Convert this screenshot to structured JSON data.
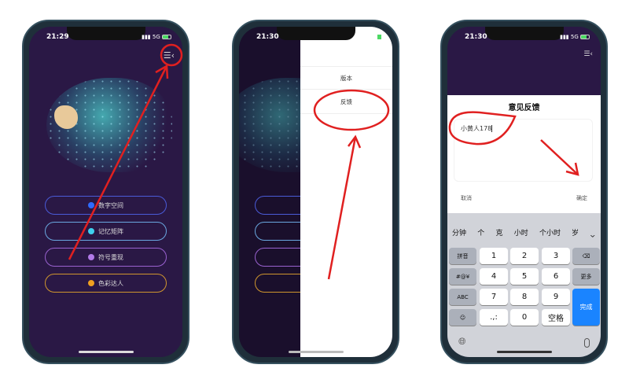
{
  "phone1": {
    "time": "21:29",
    "network": "5G",
    "menu_icon": "menu-collapse-icon",
    "buttons": [
      {
        "label": "数字空间",
        "color": "#2f6bff",
        "border": "#4a5bd8"
      },
      {
        "label": "记忆矩阵",
        "color": "#3fd0ee",
        "border": "#6aa8e0"
      },
      {
        "label": "符号重现",
        "color": "#b27be8",
        "border": "#9a62d0"
      },
      {
        "label": "色彩达人",
        "color": "#f0a020",
        "border": "#d0962e"
      }
    ]
  },
  "phone2": {
    "time": "21:30",
    "drawer_items": [
      "版本",
      "反馈"
    ]
  },
  "phone3": {
    "time": "21:30",
    "network": "5G",
    "dialog": {
      "title": "意见反馈",
      "input_value": "小黄人178",
      "cancel": "取消",
      "confirm": "确定"
    },
    "keyboard": {
      "candidates": [
        "分钟",
        "个",
        "克",
        "小时",
        "个小时",
        "岁",
        "^"
      ],
      "left_keys": [
        "拼音",
        "#@¥",
        "ABC",
        "☺"
      ],
      "digits": [
        [
          "1",
          "2",
          "3"
        ],
        [
          "4",
          "5",
          "6"
        ],
        [
          "7",
          "8",
          "9"
        ],
        [
          ".,:",
          "0",
          "空格"
        ]
      ],
      "right_keys": [
        "⌫",
        "更多"
      ],
      "done": "完成"
    }
  },
  "annotation_color": "#e02020"
}
